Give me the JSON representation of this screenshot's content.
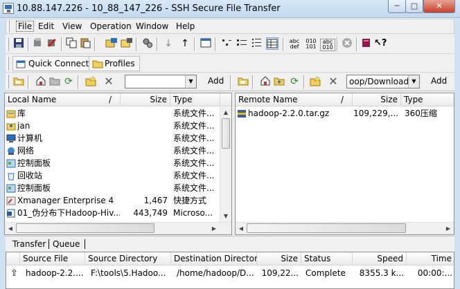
{
  "window": {
    "title": "10.88.147.226 - 10_88_147_226 - SSH Secure File Transfer",
    "minimize_glyph": "─",
    "maximize_glyph": "□",
    "close_glyph": "✕"
  },
  "menu": {
    "items": [
      "File",
      "Edit",
      "View",
      "Operation",
      "Window",
      "Help"
    ]
  },
  "toolbar": {
    "icons": [
      "save-icon",
      "connect-icon",
      "disconnect-icon",
      "copy-icon",
      "paste-icon",
      "new-connection-icon",
      "new-sftp-icon",
      "settings-icon",
      "download-icon",
      "upload-icon",
      "terminal-icon",
      "list-view-icon",
      "detail-view-icon",
      "tree-view-icon",
      "grid-view-icon",
      "ascii-mode-icon",
      "binary-mode-icon",
      "auto-mode-icon",
      "stop-icon",
      "help-book-icon",
      "whats-this-icon"
    ],
    "ascii_label": "abc def",
    "binary_label": "010 101",
    "auto_label": "abç 010"
  },
  "quick_bar": {
    "quick_connect_label": "Quick Connect",
    "profiles_label": "Profiles"
  },
  "local_nav": {
    "path_value": "",
    "add_label": "Add"
  },
  "remote_nav": {
    "path_value": "oop/Downloads",
    "add_label": "Add"
  },
  "local_pane": {
    "columns": {
      "name": "Local Name",
      "sort_indicator": "/",
      "size": "Size",
      "type": "Type"
    },
    "rows": [
      {
        "name": "库",
        "size": "",
        "type": "系统文件...",
        "icon": "library-icon"
      },
      {
        "name": "jan",
        "size": "",
        "type": "系统文件...",
        "icon": "user-folder-icon"
      },
      {
        "name": "计算机",
        "size": "",
        "type": "系统文件...",
        "icon": "computer-icon"
      },
      {
        "name": "网络",
        "size": "",
        "type": "系统文件...",
        "icon": "network-icon"
      },
      {
        "name": "控制面板",
        "size": "",
        "type": "系统文件...",
        "icon": "control-panel-icon"
      },
      {
        "name": "回收站",
        "size": "",
        "type": "系统文件...",
        "icon": "recycle-bin-icon"
      },
      {
        "name": "控制面板",
        "size": "",
        "type": "系统文件...",
        "icon": "control-panel-icon"
      },
      {
        "name": "Xmanager Enterprise 4",
        "size": "1,467",
        "type": "快捷方式",
        "icon": "shortcut-icon"
      },
      {
        "name": "01_伪分布下Hadoop-Hiv...",
        "size": "443,749",
        "type": "Microso...",
        "icon": "word-document-icon"
      }
    ]
  },
  "remote_pane": {
    "columns": {
      "name": "Remote Name",
      "sort_indicator": "/",
      "size": "Size",
      "type": "Type"
    },
    "rows": [
      {
        "name": "hadoop-2.2.0.tar.gz",
        "size": "109,229,...",
        "type": "360压缩",
        "icon": "archive-icon"
      }
    ]
  },
  "transfer_tabs": [
    "Transfer",
    "Queue"
  ],
  "transfer_pane": {
    "columns": [
      "",
      "Source File",
      "Source Directory",
      "Destination Directory",
      "Size",
      "Status",
      "Speed",
      "Time"
    ],
    "rows": [
      {
        "direction": "⇧",
        "source_file": "hadoop-2.2....",
        "source_dir": "F:\\tools\\5.Hadoo...",
        "dest_dir": "/home/hadoop/D...",
        "size": "109,22...",
        "status": "Complete",
        "speed": "8355.3 k...",
        "time": "00:00:..."
      }
    ]
  },
  "colors": {
    "title_bar": "#c3d9ef",
    "window_bg": "#f0f0f0",
    "close_button": "#c7402b"
  }
}
